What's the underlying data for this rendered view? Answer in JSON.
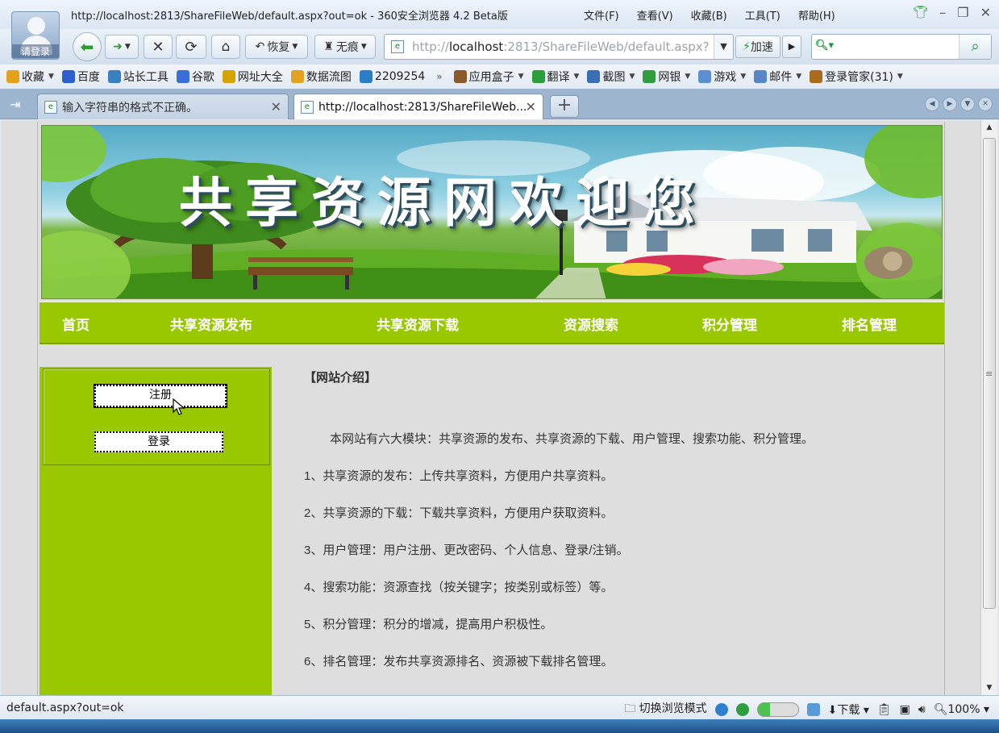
{
  "browser": {
    "window_title": "http://localhost:2813/ShareFileWeb/default.aspx?out=ok - 360安全浏览器 4.2 Beta版",
    "avatar_label": "请登录",
    "menus": [
      "文件(F)",
      "查看(V)",
      "收藏(B)",
      "工具(T)",
      "帮助(H)"
    ],
    "toolbar": {
      "restore_label": "恢复",
      "incognito_label": "无痕",
      "speed_label": "加速"
    },
    "address": {
      "scheme": "http://",
      "host": "localhost",
      "rest": ":2813/ShareFileWeb/default.aspx?"
    },
    "bookmarks": [
      {
        "label": "收藏",
        "color": "#e3a11c",
        "icon": "star-icon",
        "dropdown": true
      },
      {
        "label": "百度",
        "color": "#2d5fd1",
        "icon": "baidu-paw-icon"
      },
      {
        "label": "站长工具",
        "color": "#3a7fc0",
        "icon": "page-icon"
      },
      {
        "label": "谷歌",
        "color": "#3a6fd8",
        "icon": "google-icon"
      },
      {
        "label": "网址大全",
        "color": "#d6a400",
        "icon": "plus-circle-icon"
      },
      {
        "label": "数据流图",
        "color": "#e2a21f",
        "icon": "document-icon"
      },
      {
        "label": "2209254",
        "color": "#2a7ec8",
        "icon": "globe-icon"
      }
    ],
    "bookmarks_right": [
      {
        "label": "应用盒子",
        "color": "#8a5a2a",
        "icon": "box-icon"
      },
      {
        "label": "翻译",
        "color": "#2e9d3b",
        "icon": "translate-icon"
      },
      {
        "label": "截图",
        "color": "#3b6fb5",
        "icon": "scissors-icon"
      },
      {
        "label": "网银",
        "color": "#2f9e3f",
        "icon": "bank-icon"
      },
      {
        "label": "游戏",
        "color": "#5a8fd0",
        "icon": "gamepad-icon"
      },
      {
        "label": "邮件",
        "color": "#5a86c8",
        "icon": "mail-icon"
      },
      {
        "label": "登录管家(31)",
        "color": "#a96b1c",
        "icon": "key-icon"
      }
    ],
    "tabs": [
      {
        "label": "输入字符串的格式不正确。",
        "active": false
      },
      {
        "label": "http://localhost:2813/ShareFileWeb...",
        "active": true
      }
    ],
    "status": {
      "url": "default.aspx?out=ok",
      "mode_label": "切换浏览模式",
      "download_label": "下载",
      "zoom": "100%"
    }
  },
  "site": {
    "banner_title": "共享资源网欢迎您",
    "nav": [
      "首页",
      "共享资源发布",
      "共享资源下载",
      "资源搜索",
      "积分管理",
      "排名管理"
    ],
    "register_label": "注册",
    "login_label": "登录",
    "intro_heading": "【网站介绍】",
    "intro_lead": "本网站有六大模块：共享资源的发布、共享资源的下载、用户管理、搜索功能、积分管理。",
    "intro_items": [
      "1、共享资源的发布：上传共享资料，方便用户共享资料。",
      "2、共享资源的下载：下载共享资料，方便用户获取资料。",
      "3、用户管理：用户注册、更改密码、个人信息、登录/注销。",
      "4、搜索功能：资源查找（按关键字；按类别或标签）等。",
      "5、积分管理：积分的增减，提高用户积极性。",
      "6、排名管理：发布共享资源排名、资源被下载排名管理。"
    ]
  },
  "colors": {
    "nav_green": "#99c800",
    "browser_chrome": "#dbe6f3",
    "content_bg": "#dedede"
  }
}
